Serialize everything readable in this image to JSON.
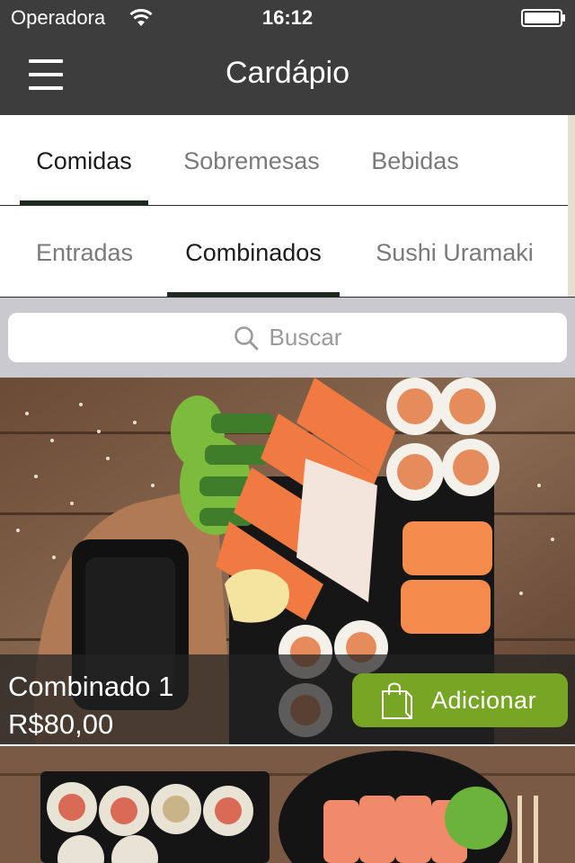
{
  "status_bar": {
    "carrier": "Operadora",
    "time": "16:12"
  },
  "nav": {
    "title": "Cardápio",
    "menu_icon": "hamburger-menu-icon"
  },
  "category_tabs": [
    {
      "label": "Comidas",
      "active": true
    },
    {
      "label": "Sobremesas",
      "active": false
    },
    {
      "label": "Bebidas",
      "active": false
    }
  ],
  "subcategory_tabs": [
    {
      "label": "Entradas",
      "active": false
    },
    {
      "label": "Combinados",
      "active": true
    },
    {
      "label": "Sushi Uramaki",
      "active": false
    }
  ],
  "search": {
    "placeholder": "Buscar",
    "icon": "magnifier-icon"
  },
  "products": [
    {
      "name": "Combinado 1",
      "price": "R$80,00",
      "add_label": "Adicionar",
      "add_icon": "shopping-bag-icon"
    }
  ],
  "colors": {
    "bar": "#3d3d3d",
    "accent": "#76a623",
    "tab_indicator": "#1e2a1e",
    "search_bg": "#c9c9cf"
  }
}
